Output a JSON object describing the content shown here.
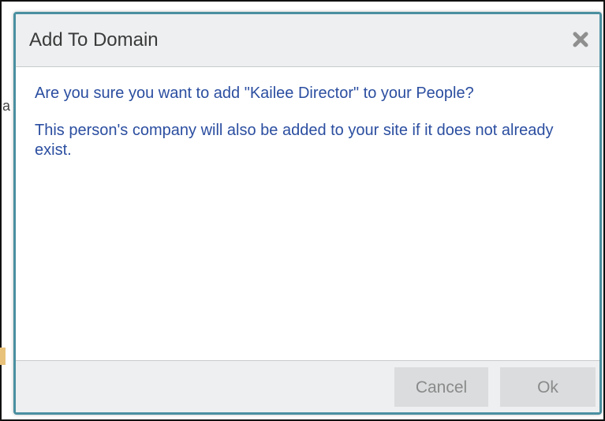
{
  "dialog": {
    "title": "Add To Domain",
    "message": "Are you sure you want to add \"Kailee Director\" to your People?",
    "note": "This person's company will also be added to your site if it does not already exist.",
    "cancel_label": "Cancel",
    "ok_label": "Ok",
    "close_icon": "close-x-icon"
  },
  "background": {
    "partial_letter": "a"
  },
  "colors": {
    "dialog_border": "#4a8fa0",
    "body_text": "#2b4ea0",
    "header_bg": "#edeff0",
    "button_bg": "#dadcdd"
  }
}
